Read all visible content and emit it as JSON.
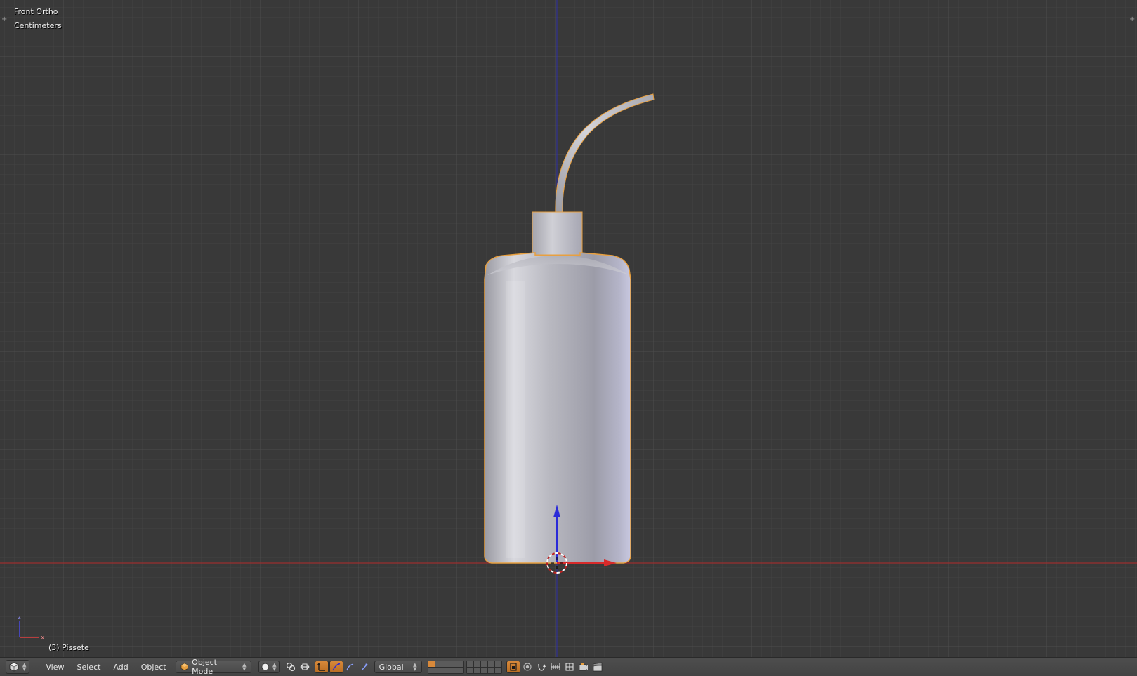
{
  "viewport": {
    "view_name": "Front Ortho",
    "units": "Centimeters",
    "active_object": "(3) Pissete"
  },
  "header": {
    "menus": [
      "View",
      "Select",
      "Add",
      "Object"
    ],
    "mode": "Object Mode",
    "orientation": "Global"
  },
  "icons": {
    "editor_type": "3d-view-cube-icon",
    "mode": "object-mode-cube-icon",
    "shading": "solid-sphere-icon",
    "pivot": "pivot-point-icon",
    "manipulator_toggle": "manipulator-icon",
    "translate": "translate-arrow-icon",
    "rotate": "rotate-arc-icon",
    "scale": "scale-icon",
    "layer_lock": "layer-lock-icon",
    "proportional_edit": "proportional-edit-icon",
    "snap": "magnet-icon",
    "snap_target": "snap-target-icon",
    "render_preview": "camera-render-icon",
    "render_anim": "clapperboard-icon"
  },
  "colors": {
    "viewport_bg": "#393939",
    "grid_minor": "#444444",
    "grid_major": "#4b4b4b",
    "x_axis": "#d02828",
    "z_axis": "#2828c8",
    "selection_outline": "#e8a040",
    "active_toggle": "#d8893a"
  }
}
